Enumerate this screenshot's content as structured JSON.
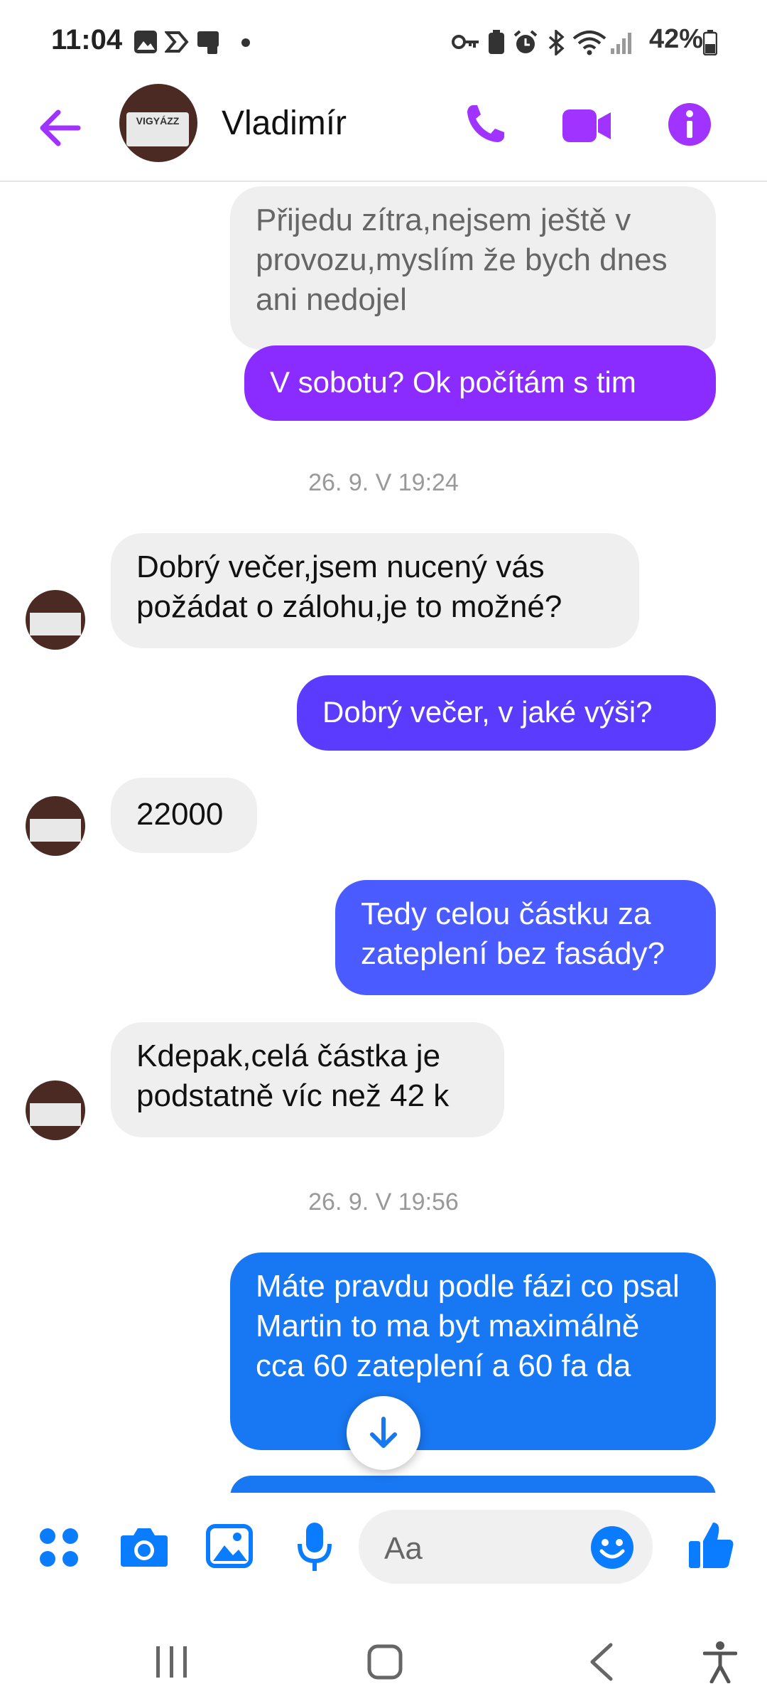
{
  "status_bar": {
    "time": "11:04",
    "battery": "42%"
  },
  "header": {
    "contact_name": "Vladimír",
    "avatar_text": "VIGYÁZZ"
  },
  "colors": {
    "accent": "#a033ff",
    "purple_bubble": "#8a2bff",
    "indigo_bubble": "#5b3cff",
    "blue_bubble": "#1877f2",
    "messenger_blue": "#0084ff"
  },
  "messages": [
    {
      "dir": "in",
      "text": "Přijedu zítra,nejsem ještě v provozu,myslím že bych dnes ani nedojel"
    },
    {
      "dir": "out",
      "text": "V sobotu? Ok počítám s tim"
    },
    {
      "type": "timestamp",
      "text": "26. 9. V 19:24"
    },
    {
      "dir": "in",
      "text": "Dobrý večer,jsem nucený vás požádat o zálohu,je to možné?"
    },
    {
      "dir": "out",
      "text": "Dobrý večer, v jaké výši?"
    },
    {
      "dir": "in",
      "text": "22000"
    },
    {
      "dir": "out",
      "text": "Tedy celou částku za zateplení bez fasády?"
    },
    {
      "dir": "in",
      "text": "Kdepak,celá částka je podstatně víc než 42 k"
    },
    {
      "type": "timestamp",
      "text": "26. 9. V 19:56"
    },
    {
      "dir": "out",
      "text": "Máte pravdu podle fázi co psal Martin to ma byt maximálně  cca 60 zateplení a 60 fa  da"
    }
  ],
  "composer": {
    "placeholder": "Aa"
  },
  "icons": [
    "back-arrow-icon",
    "phone-icon",
    "video-icon",
    "info-icon",
    "apps-icon",
    "camera-icon",
    "gallery-icon",
    "mic-icon",
    "emoji-icon",
    "thumbs-up-icon",
    "scroll-down-icon"
  ]
}
